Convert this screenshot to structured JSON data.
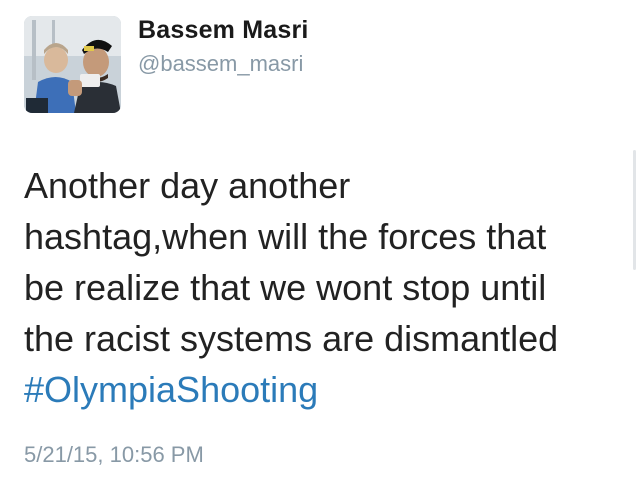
{
  "author": {
    "display_name": "Bassem Masri",
    "handle": "@bassem_masri",
    "avatar": "profile-photo"
  },
  "tweet": {
    "lines": [
      "Another day another",
      "hashtag,when will the forces that",
      "be realize that we wont stop until",
      "the racist systems are dismantled"
    ],
    "hashtag": "#OlympiaShooting",
    "timestamp": "5/21/15, 10:56 PM"
  },
  "colors": {
    "text": "#222222",
    "muted": "#8899a6",
    "link": "#2b7bb9"
  }
}
